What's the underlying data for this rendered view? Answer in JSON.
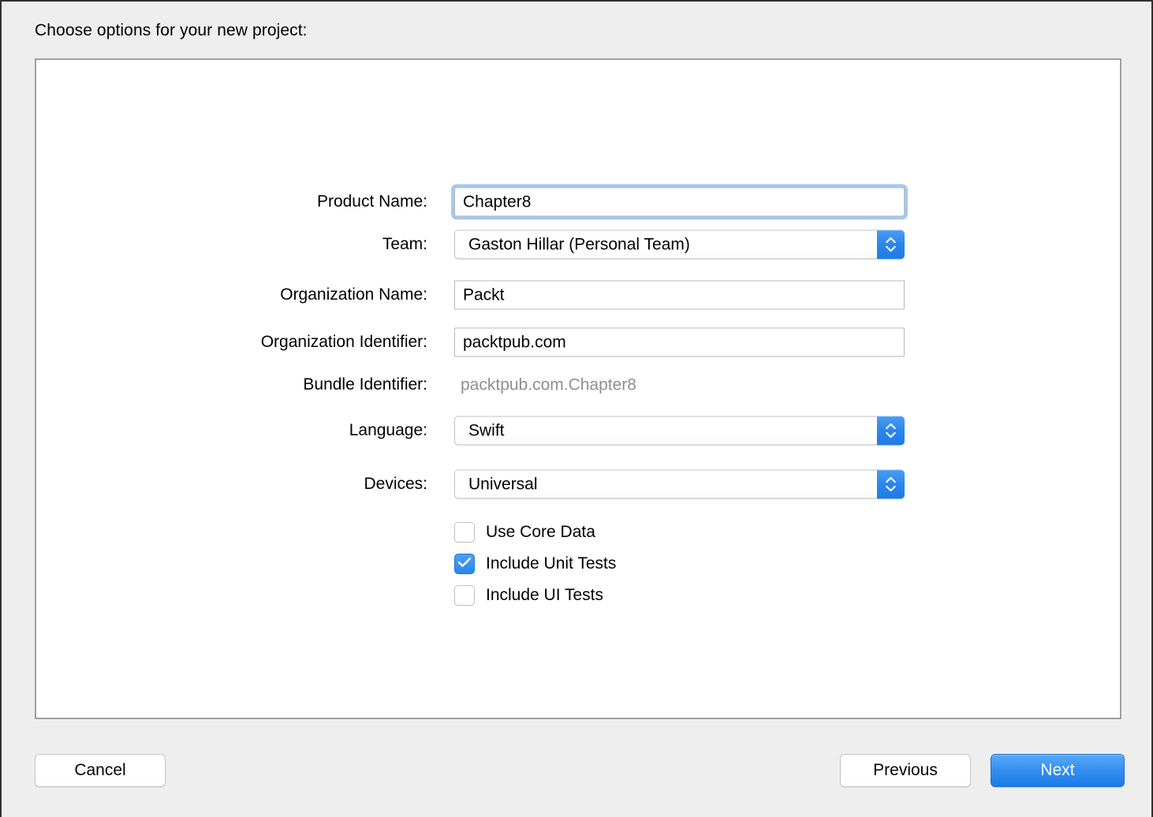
{
  "dialog": {
    "title": "Choose options for your new project:"
  },
  "form": {
    "rows": [
      {
        "label": "Product Name:",
        "value": "Chapter8",
        "type": "textfield",
        "focused": true
      },
      {
        "label": "Team:",
        "value": "Gaston Hillar (Personal Team)",
        "type": "popup"
      },
      {
        "label": "Organization Name:",
        "value": "Packt",
        "type": "textfield",
        "focused": false
      },
      {
        "label": "Organization Identifier:",
        "value": "packtpub.com",
        "type": "textfield",
        "focused": false
      },
      {
        "label": "Bundle Identifier:",
        "value": "packtpub.com.Chapter8",
        "type": "static"
      },
      {
        "label": "Language:",
        "value": "Swift",
        "type": "popup"
      },
      {
        "label": "Devices:",
        "value": "Universal",
        "type": "popup"
      }
    ]
  },
  "checkboxes": [
    {
      "label": "Use Core Data",
      "checked": false
    },
    {
      "label": "Include Unit Tests",
      "checked": true
    },
    {
      "label": "Include UI Tests",
      "checked": false
    }
  ],
  "footer": {
    "cancel_label": "Cancel",
    "previous_label": "Previous",
    "next_label": "Next"
  },
  "colors": {
    "accent_blue": "#2b87ec",
    "focus_ring": "#a5c9ef",
    "disabled_text": "#8f8f8f",
    "window_bg": "#eeeeee",
    "panel_bg": "#ffffff",
    "panel_border": "#a0a0a0"
  },
  "icons": {
    "stepper": "chevron-up-down-icon",
    "checkmark": "checkmark-icon"
  }
}
